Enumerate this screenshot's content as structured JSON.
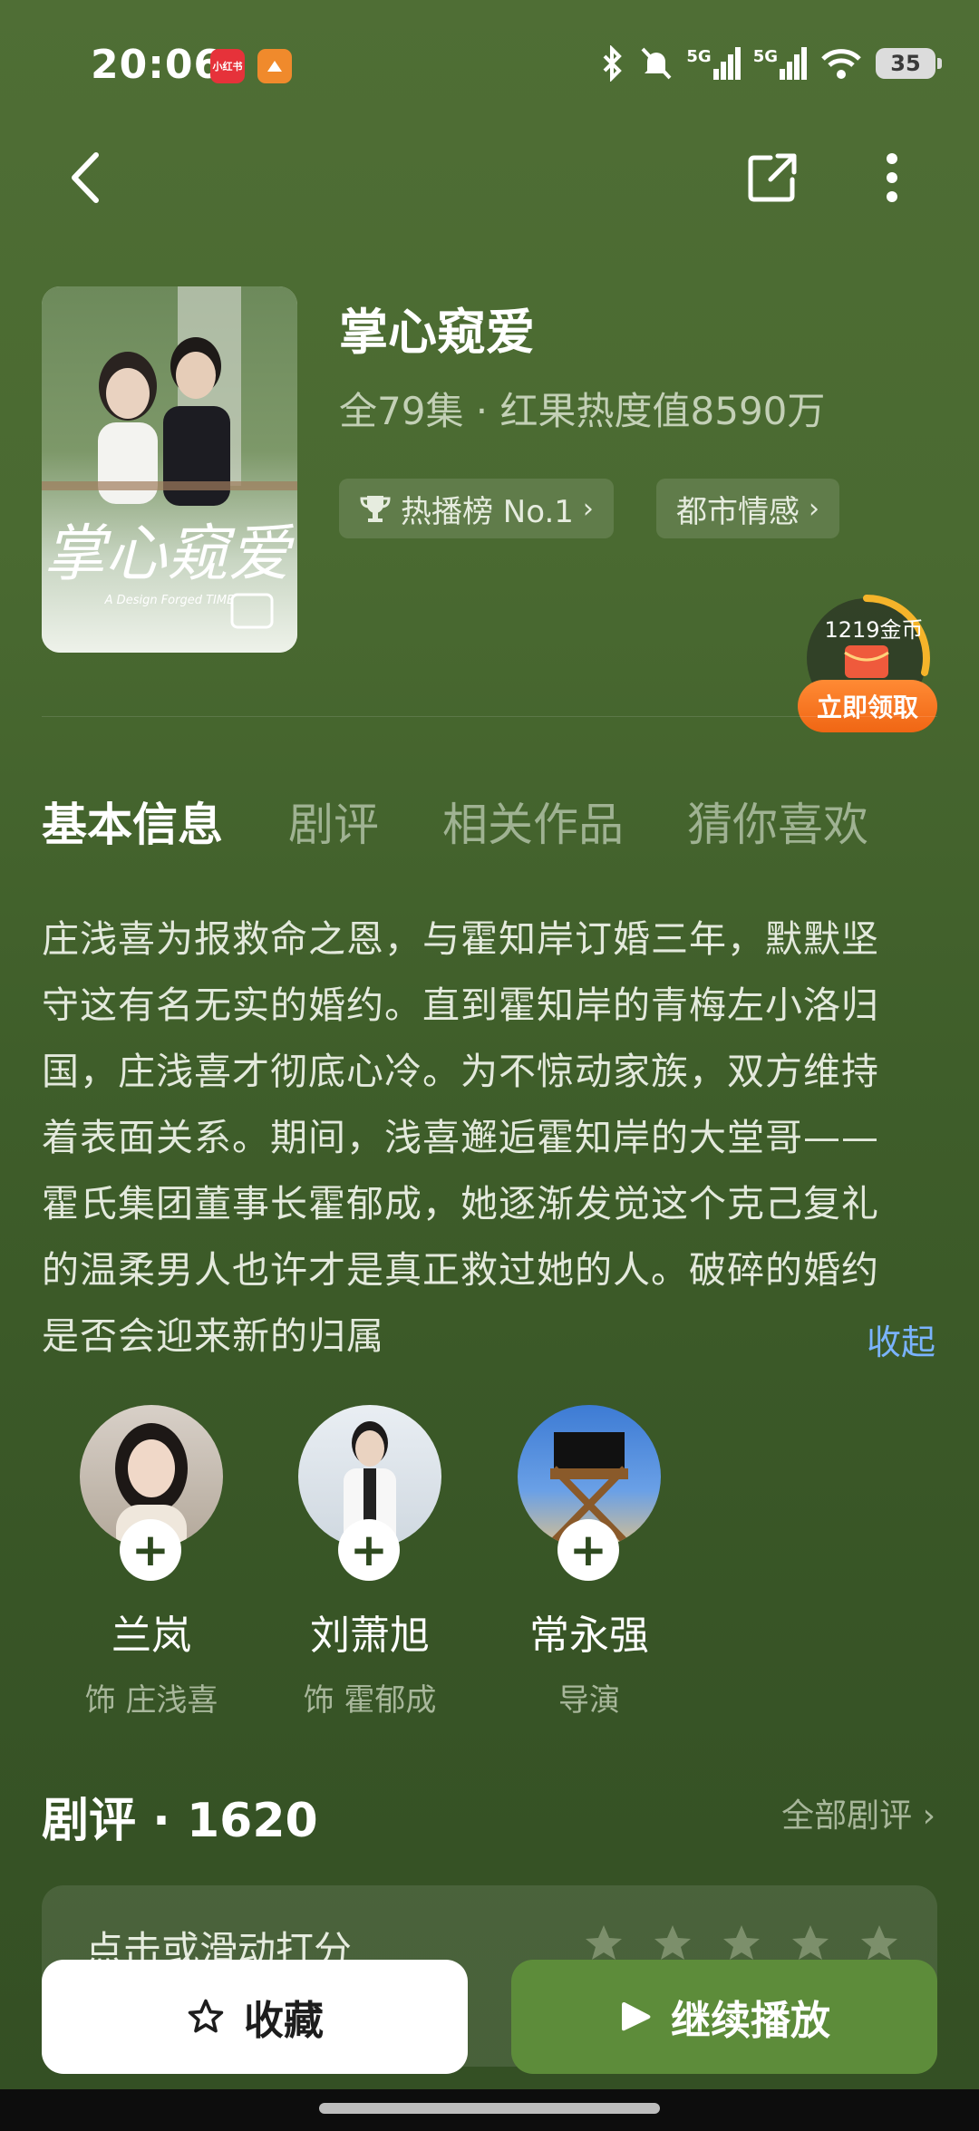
{
  "status": {
    "time": "20:06",
    "badge1": "小红书",
    "network1": "5G",
    "network2": "5G",
    "battery": "35"
  },
  "drama": {
    "title": "掌心窥爱",
    "meta": "全79集 · 红果热度值8590万",
    "tags": [
      "热播榜 No.1",
      "都市情感"
    ],
    "poster_title_art": "掌心窥爱",
    "poster_subtitle": "A Design Forged TIME"
  },
  "reward": {
    "amount": "1219金币",
    "button": "立即领取"
  },
  "tabs": [
    "基本信息",
    "剧评",
    "相关作品",
    "猜你喜欢"
  ],
  "description": {
    "lines": [
      "庄浅喜为报救命之恩，与霍知岸订婚三年，默默坚",
      "守这有名无实的婚约。直到霍知岸的青梅左小洛归",
      "国，庄浅喜才彻底心冷。为不惊动家族，双方维持",
      "着表面关系。期间，浅喜邂逅霍知岸的大堂哥——",
      "霍氏集团董事长霍郁成，她逐渐发觉这个克己复礼",
      "的温柔男人也许才是真正救过她的人。破碎的婚约",
      "是否会迎来新的归属"
    ],
    "collapse": "收起"
  },
  "cast": [
    {
      "name": "兰岚",
      "role": "饰 庄浅喜"
    },
    {
      "name": "刘萧旭",
      "role": "饰 霍郁成"
    },
    {
      "name": "常永强",
      "role": "导演"
    }
  ],
  "reviews": {
    "heading": "剧评 · 1620",
    "all": "全部剧评",
    "rate_prompt": "点击或滑动打分"
  },
  "actions": {
    "favorite": "收藏",
    "continue": "继续播放"
  },
  "colors": {
    "accent_green": "#5d8c3a",
    "reward_orange": "#f06614",
    "link_blue": "#7ab3ff"
  }
}
